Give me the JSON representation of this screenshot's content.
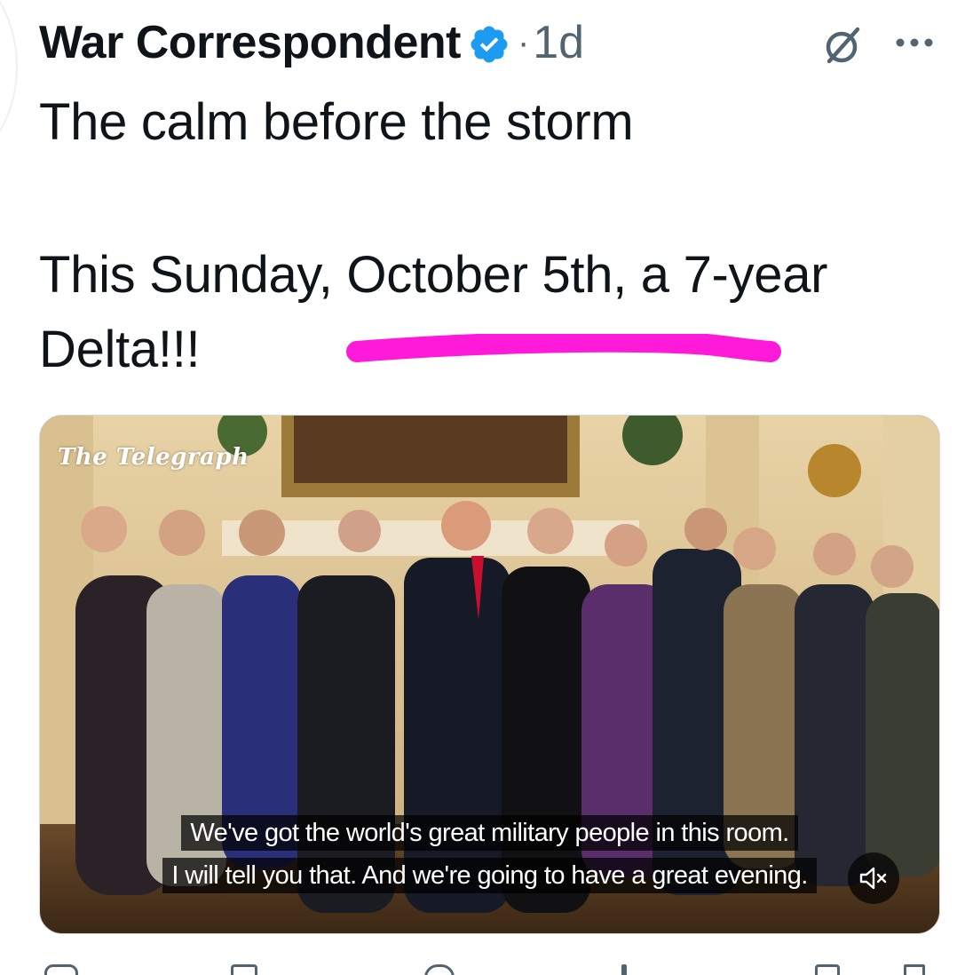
{
  "post": {
    "author": "War Correspondent",
    "separator": "·",
    "timestamp": "1d",
    "text_line1": "The calm before the storm",
    "text_line2": "This Sunday, October 5th, a 7-year",
    "text_line3": "Delta!!!"
  },
  "media": {
    "watermark": "The Telegraph",
    "caption_line1": "We've got the world's great military people in this room.",
    "caption_line2": "I will tell you that. And we're going to have a great evening."
  },
  "icons": {
    "verified": "verified-badge-icon",
    "grok": "grok-icon",
    "more": "more-icon",
    "mute": "muted-speaker-icon"
  },
  "colors": {
    "verified": "#1d9bf0",
    "highlight": "#ff1ad9",
    "muted_text": "#536471"
  }
}
